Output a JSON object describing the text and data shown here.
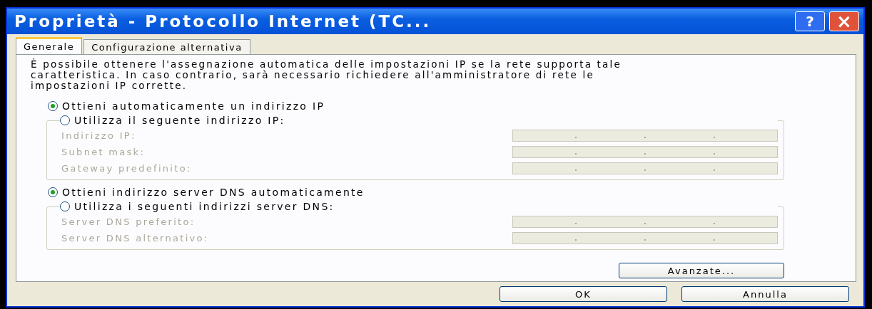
{
  "window": {
    "title": "Proprietà - Protocollo Internet (TC...",
    "help_button": "?",
    "close_button": "×"
  },
  "tabs": [
    {
      "label": "Generale",
      "selected": true
    },
    {
      "label": "Configurazione alternativa",
      "selected": false
    }
  ],
  "description": "È possibile ottenere l'assegnazione automatica delle impostazioni IP se la rete supporta tale caratteristica. In caso contrario, sarà necessario richiedere all'amministratore di rete le impostazioni IP corrette.",
  "sections": [
    {
      "options": [
        {
          "label": "Ottieni automaticamente un indirizzo IP",
          "selected": true
        },
        {
          "label": "Utilizza il seguente indirizzo IP:",
          "selected": false
        }
      ],
      "fields": [
        {
          "label": "Indirizzo IP:",
          "disabled": true
        },
        {
          "label": "Subnet mask:",
          "disabled": true
        },
        {
          "label": "Gateway predefinito:",
          "disabled": true
        }
      ]
    },
    {
      "options": [
        {
          "label": "Ottieni indirizzo server DNS automaticamente",
          "selected": true
        },
        {
          "label": "Utilizza i seguenti indirizzi server DNS:",
          "selected": false
        }
      ],
      "fields": [
        {
          "label": "Server DNS preferito:",
          "disabled": true
        },
        {
          "label": "Server DNS alternativo:",
          "disabled": true
        }
      ]
    }
  ],
  "advanced_button": "Avanzate...",
  "buttons": [
    "OK",
    "Annulla"
  ]
}
